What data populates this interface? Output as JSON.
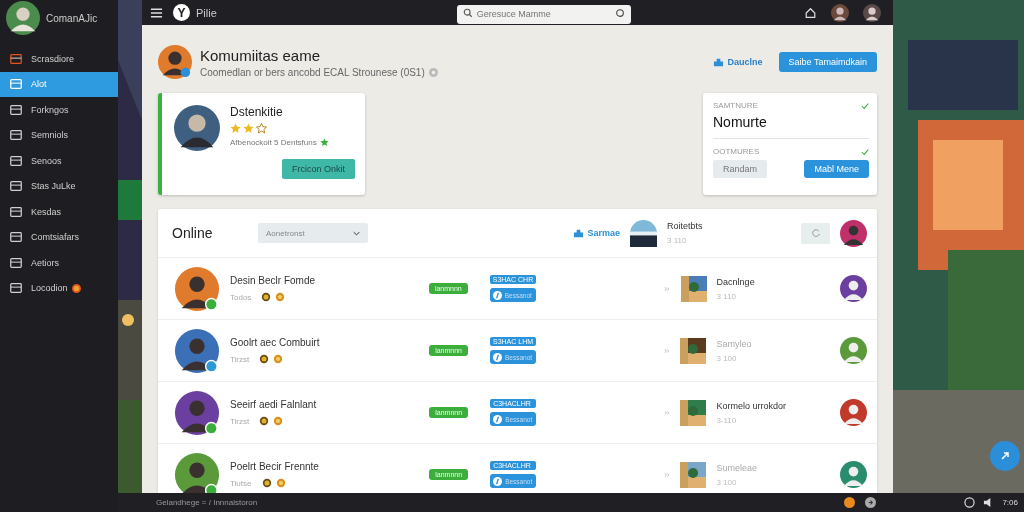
{
  "sidebar": {
    "profile_name": "ComanAJic",
    "items": [
      {
        "label": "Scrasdiore",
        "selected": false,
        "badge": false
      },
      {
        "label": "Alot",
        "selected": true,
        "badge": false
      },
      {
        "label": "Forkngos",
        "selected": false,
        "badge": false
      },
      {
        "label": "Semniols",
        "selected": false,
        "badge": false
      },
      {
        "label": "Senoos",
        "selected": false,
        "badge": false
      },
      {
        "label": "Stas JuLke",
        "selected": false,
        "badge": false
      },
      {
        "label": "Kesdas",
        "selected": false,
        "badge": false
      },
      {
        "label": "Comtsiafars",
        "selected": false,
        "badge": false
      },
      {
        "label": "Aetiors",
        "selected": false,
        "badge": false
      },
      {
        "label": "Locodion",
        "selected": false,
        "badge": true
      }
    ]
  },
  "topbar": {
    "logo": "Y",
    "title": "Pilie",
    "search": {
      "placeholder": "Geresuce Mamme"
    }
  },
  "header": {
    "title": "Komumiitas eame",
    "subtitle": "Coomedlan or bers ancobd ECAL Strounese (0S1)",
    "link": "Dauclne",
    "button": "Saibe Tamaimdkain"
  },
  "profile_card": {
    "name": "Dstenkitie",
    "stars": 2,
    "text": "Afbenockoit 5 Dentsfuns",
    "button": "Frcicon Onkit"
  },
  "settings_card": {
    "label_1": "SAMTNURE",
    "value": "Nomurte",
    "label_2": "OOTMURES",
    "button_1": "Randam",
    "button_2": "Mabl Mene"
  },
  "list": {
    "title": "Online",
    "dropdown": "Aonetronst",
    "link": "Sarmae",
    "featured": {
      "name": "Roitetbts",
      "count": "3 110"
    },
    "rows": [
      {
        "name": "Desin Beclr Fomde",
        "sub": "Todos",
        "badge": "lanmnnn",
        "tag": "S3HAC CHR",
        "button": "Bessanot",
        "game": "Dacnlnge",
        "count": "3 110",
        "dim": false
      },
      {
        "name": "Goolrt aec Combuirt",
        "sub": "Tirzst",
        "badge": "lanmnnn",
        "tag": "S3HAC LHM",
        "button": "Bessanot",
        "game": "Samyleo",
        "count": "3 100",
        "dim": true
      },
      {
        "name": "Seeirf aedi Falnlant",
        "sub": "Tirzst",
        "badge": "lanmnnn",
        "tag": "C3HACLHR",
        "button": "Bessanot",
        "game": "Kormelo urrokdor",
        "count": "3-110",
        "dim": false
      },
      {
        "name": "Poelrt Becir Frennte",
        "sub": "Tiutse",
        "badge": "lanmnnn",
        "tag": "C3HACLHR",
        "button": "Bessanot",
        "game": "Sumeleae",
        "count": "3 100",
        "dim": true
      }
    ]
  },
  "status_bar": {
    "text": "Gelandhege = / Innnalstoron",
    "clock": "7:06"
  }
}
